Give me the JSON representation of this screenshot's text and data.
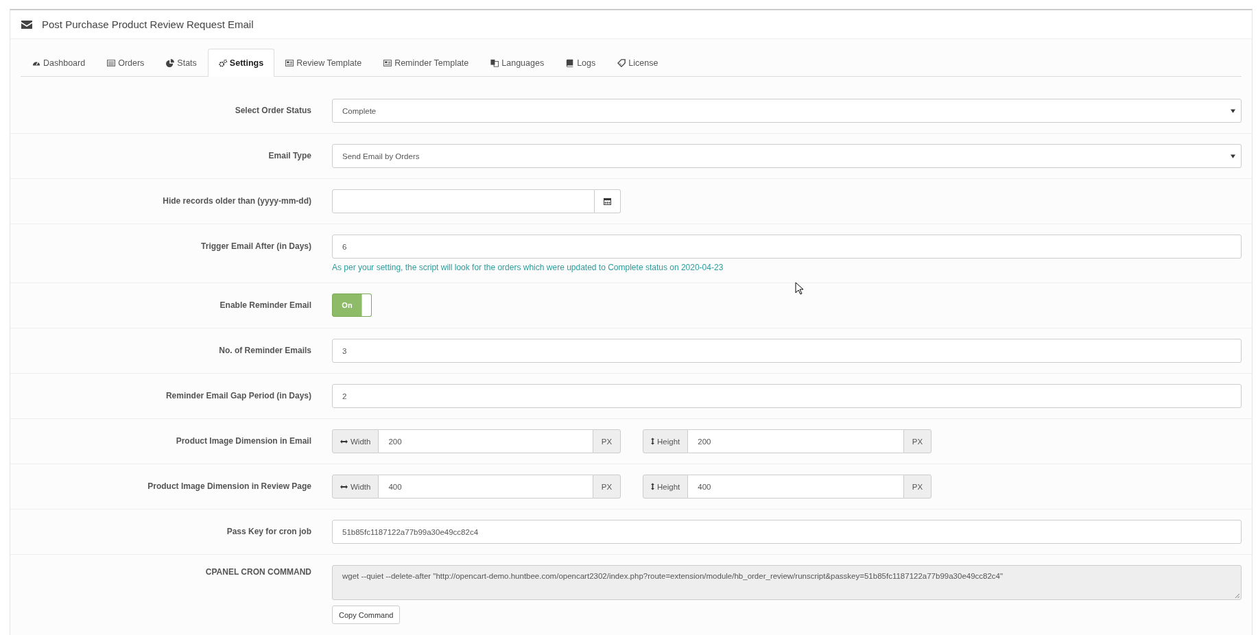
{
  "panel": {
    "title": "Post Purchase Product Review Request Email"
  },
  "tabs": [
    {
      "label": "Dashboard",
      "selected": false
    },
    {
      "label": "Orders",
      "selected": false
    },
    {
      "label": "Stats",
      "selected": false
    },
    {
      "label": "Settings",
      "selected": true
    },
    {
      "label": "Review Template",
      "selected": false
    },
    {
      "label": "Reminder Template",
      "selected": false
    },
    {
      "label": "Languages",
      "selected": false
    },
    {
      "label": "Logs",
      "selected": false
    },
    {
      "label": "License",
      "selected": false
    }
  ],
  "fields": [
    {
      "kind": "select",
      "label": "Select Order Status",
      "value": "Complete"
    },
    {
      "kind": "select",
      "label": "Email Type",
      "value": "Send Email by Orders"
    },
    {
      "kind": "date",
      "label": "Hide records older than (yyyy-mm-dd)"
    },
    {
      "kind": "text",
      "label": "Trigger Email After (in Days)",
      "value": "6",
      "help": "As per your setting, the script will look for the orders which were updated to Complete status on 2020-04-23"
    },
    {
      "kind": "toggle",
      "label": "Enable Reminder Email",
      "on": true,
      "state_label": "On"
    },
    {
      "kind": "text",
      "label": "No. of Reminder Emails",
      "value": "3"
    },
    {
      "kind": "text",
      "label": "Reminder Email Gap Period (in Days)",
      "value": "2"
    },
    {
      "kind": "dimension",
      "label": "Product Image Dimension in Email",
      "width": {
        "label": "Width",
        "value": "200",
        "unit": "PX"
      },
      "height": {
        "label": "Height",
        "value": "200",
        "unit": "PX"
      }
    },
    {
      "kind": "dimension",
      "label": "Product Image Dimension in Review Page",
      "width": {
        "label": "Width",
        "value": "400",
        "unit": "PX"
      },
      "height": {
        "label": "Height",
        "value": "400",
        "unit": "PX"
      }
    },
    {
      "kind": "text",
      "label": "Pass Key for cron job",
      "value": "51b85fc1187122a77b99a30e49cc82c4"
    },
    {
      "kind": "command",
      "label": "CPANEL CRON COMMAND",
      "value": "wget --quiet --delete-after \"http://opencart-demo.huntbee.com/opencart2302/index.php?route=extension/module/hb_order_review/runscript&passkey=51b85fc1187122a77b99a30e49cc82c4\"",
      "button": "Copy Command"
    }
  ]
}
